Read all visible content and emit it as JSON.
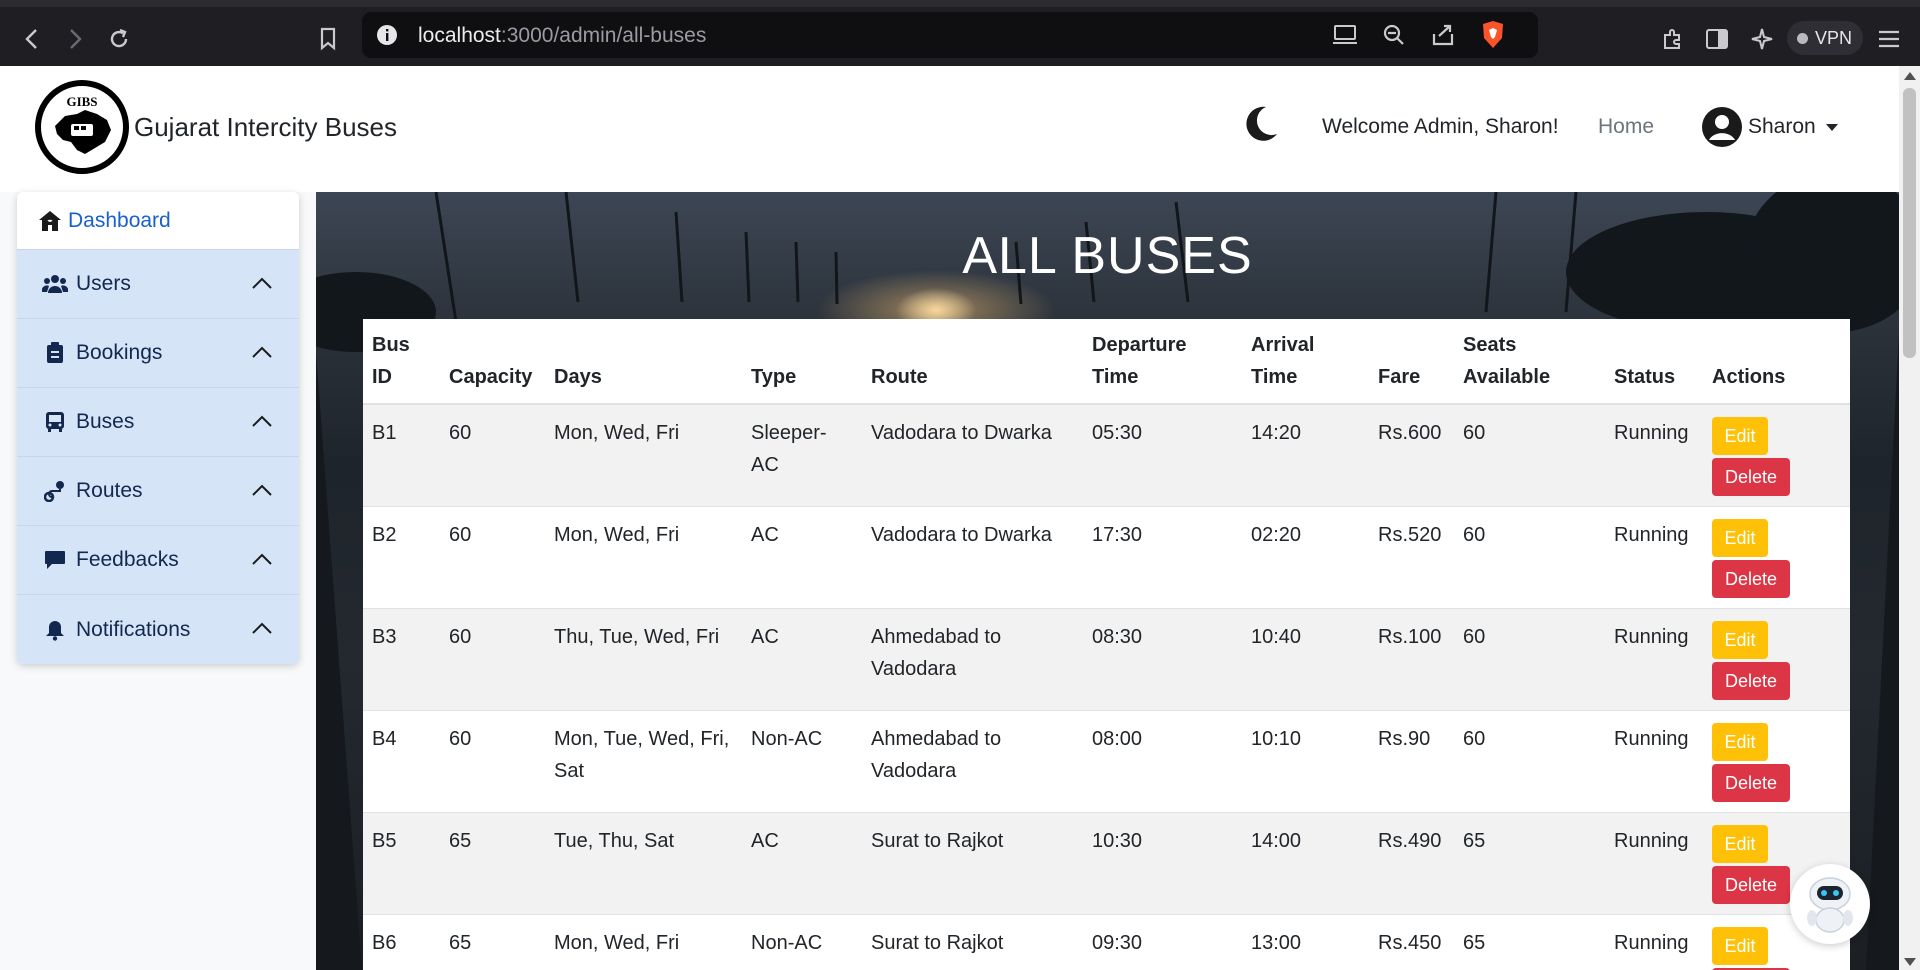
{
  "browser": {
    "url_host": "localhost",
    "url_path": ":3000/admin/all-buses",
    "vpn_label": "VPN"
  },
  "navbar": {
    "brand": "Gujarat Intercity Buses",
    "logo_text": "GIBS",
    "welcome": "Welcome Admin, Sharon!",
    "home": "Home",
    "user": "Sharon"
  },
  "sidebar": {
    "dashboard": "Dashboard",
    "items": [
      {
        "label": "Users",
        "icon": "users-icon"
      },
      {
        "label": "Bookings",
        "icon": "clipboard-icon"
      },
      {
        "label": "Buses",
        "icon": "bus-icon"
      },
      {
        "label": "Routes",
        "icon": "route-icon"
      },
      {
        "label": "Feedbacks",
        "icon": "comment-icon"
      },
      {
        "label": "Notifications",
        "icon": "bell-icon"
      }
    ]
  },
  "main": {
    "title": "ALL BUSES",
    "columns": [
      "Bus ID",
      "Capacity",
      "Days",
      "Type",
      "Route",
      "Departure Time",
      "Arrival Time",
      "Fare",
      "Seats Available",
      "Status",
      "Actions"
    ],
    "edit_label": "Edit",
    "delete_label": "Delete",
    "rows": [
      {
        "id": "B1",
        "capacity": "60",
        "days": "Mon, Wed, Fri",
        "type": "Sleeper-AC",
        "route": "Vadodara to Dwarka",
        "departure": "05:30",
        "arrival": "14:20",
        "fare": "Rs.600",
        "seats": "60",
        "status": "Running"
      },
      {
        "id": "B2",
        "capacity": "60",
        "days": "Mon, Wed, Fri",
        "type": "AC",
        "route": "Vadodara to Dwarka",
        "departure": "17:30",
        "arrival": "02:20",
        "fare": "Rs.520",
        "seats": "60",
        "status": "Running"
      },
      {
        "id": "B3",
        "capacity": "60",
        "days": "Thu, Tue, Wed, Fri",
        "type": "AC",
        "route": "Ahmedabad to Vadodara",
        "departure": "08:30",
        "arrival": "10:40",
        "fare": "Rs.100",
        "seats": "60",
        "status": "Running"
      },
      {
        "id": "B4",
        "capacity": "60",
        "days": "Mon, Tue, Wed, Fri, Sat",
        "type": "Non-AC",
        "route": "Ahmedabad to Vadodara",
        "departure": "08:00",
        "arrival": "10:10",
        "fare": "Rs.90",
        "seats": "60",
        "status": "Running"
      },
      {
        "id": "B5",
        "capacity": "65",
        "days": "Tue, Thu, Sat",
        "type": "AC",
        "route": "Surat to Rajkot",
        "departure": "10:30",
        "arrival": "14:00",
        "fare": "Rs.490",
        "seats": "65",
        "status": "Running"
      },
      {
        "id": "B6",
        "capacity": "65",
        "days": "Mon, Wed, Fri",
        "type": "Non-AC",
        "route": "Surat to Rajkot",
        "departure": "09:30",
        "arrival": "13:00",
        "fare": "Rs.450",
        "seats": "65",
        "status": "Running"
      }
    ]
  },
  "colors": {
    "accent": "#1a5fd1",
    "sidebar_bg": "#d6e4f8",
    "edit": "#ffc107",
    "delete": "#dc3545"
  }
}
